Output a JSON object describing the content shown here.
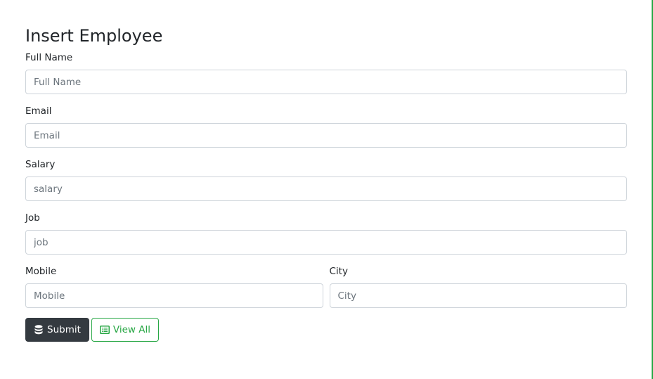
{
  "form": {
    "title": "Insert Employee",
    "fields": {
      "full_name": {
        "label": "Full Name",
        "placeholder": "Full Name",
        "value": ""
      },
      "email": {
        "label": "Email",
        "placeholder": "Email",
        "value": ""
      },
      "salary": {
        "label": "Salary",
        "placeholder": "salary",
        "value": ""
      },
      "job": {
        "label": "Job",
        "placeholder": "job",
        "value": ""
      },
      "mobile": {
        "label": "Mobile",
        "placeholder": "Mobile",
        "value": ""
      },
      "city": {
        "label": "City",
        "placeholder": "City",
        "value": ""
      }
    },
    "buttons": {
      "submit_label": "Submit",
      "submit_icon": "database-icon",
      "view_all_label": "View All",
      "view_all_icon": "list-alt-icon"
    }
  },
  "colors": {
    "accent_green": "#28a745",
    "dark_button": "#343a40",
    "input_border": "#ced4da"
  }
}
